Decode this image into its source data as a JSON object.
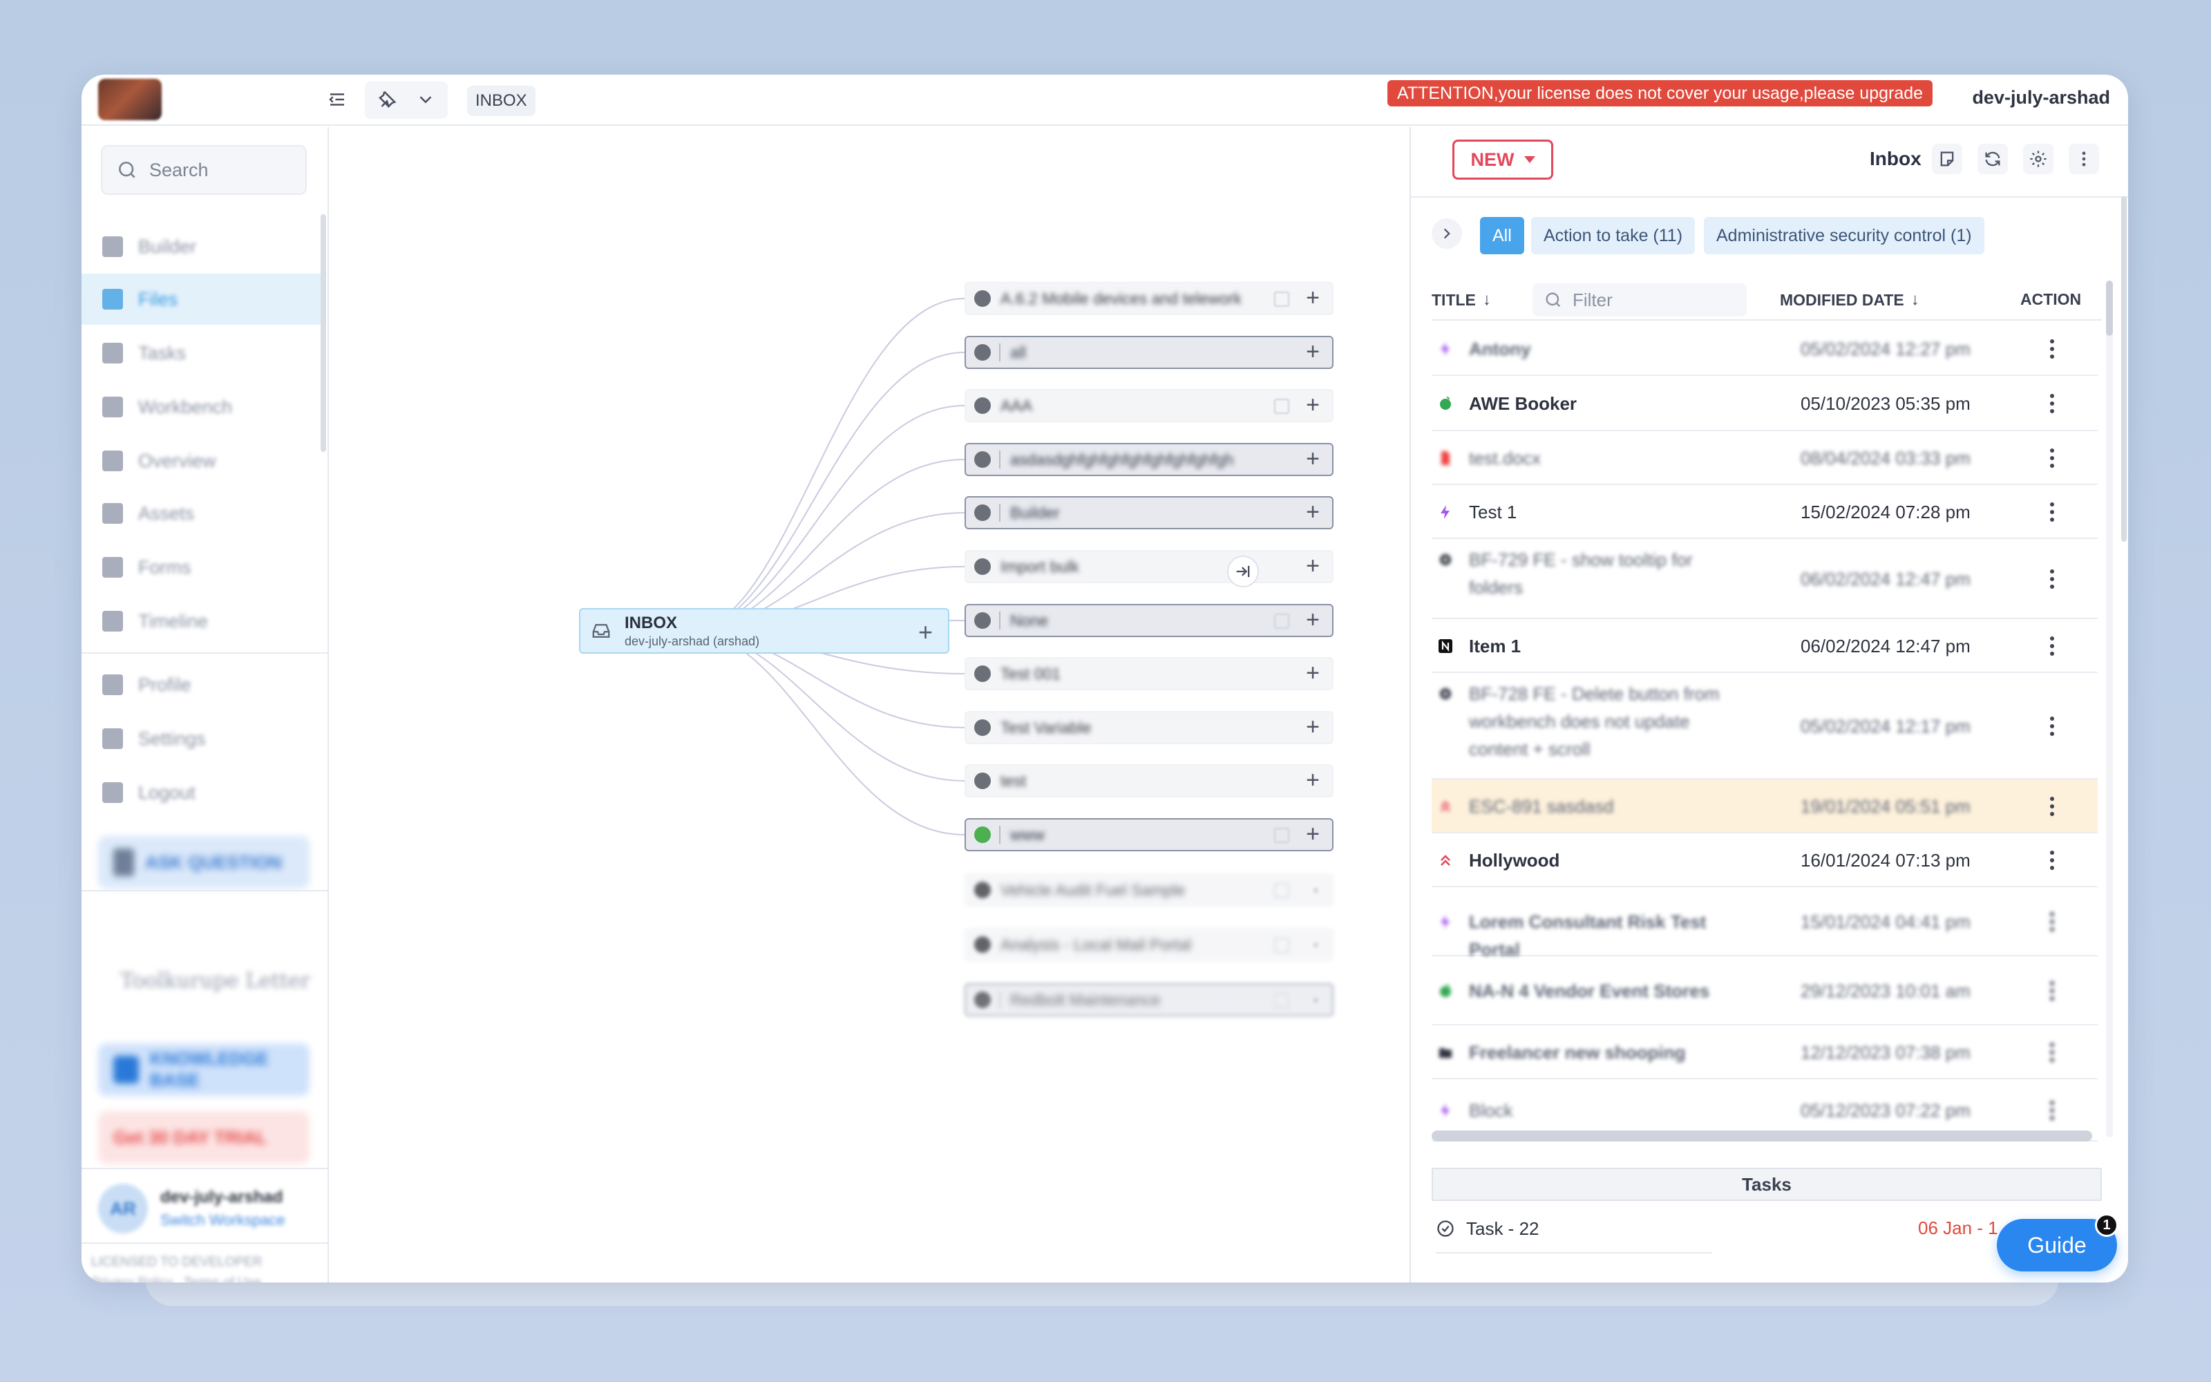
{
  "topbar": {
    "breadcrumb": "INBOX",
    "license_warning": "ATTENTION,your license does not cover your usage,please upgrade",
    "username": "dev-july-arshad"
  },
  "sidebar": {
    "search_placeholder": "Search",
    "items": [
      {
        "label": "Builder",
        "icon": "builder-icon"
      },
      {
        "label": "Files",
        "icon": "files-icon"
      },
      {
        "label": "Tasks",
        "icon": "check-icon"
      },
      {
        "label": "Workbench",
        "icon": "calendar-icon"
      },
      {
        "label": "Overview",
        "icon": "list-icon"
      },
      {
        "label": "Assets",
        "icon": "assets-icon"
      },
      {
        "label": "Forms",
        "icon": "forms-icon"
      },
      {
        "label": "Timeline",
        "icon": "timeline-icon"
      },
      {
        "label": "Profile",
        "icon": "user-icon"
      },
      {
        "label": "Settings",
        "icon": "gear-icon"
      },
      {
        "label": "Logout",
        "icon": "logout-icon"
      }
    ],
    "active_index": 1,
    "promo": {
      "ask_question": "ASK QUESTION",
      "tagline": "Toolkurupe Letter",
      "knowledge": "KNOWLEDGE BASE",
      "alert": "Get 30 DAY TRIAL"
    },
    "user": {
      "initials": "AR",
      "name": "dev-july-arshad",
      "switch": "Switch Workspace"
    },
    "footer": {
      "line1": "LICENSED TO DEVELOPER",
      "privacy": "Privacy Policy",
      "terms": "Terms of Use"
    }
  },
  "canvas": {
    "root": {
      "title": "INBOX",
      "subtitle": "dev-july-arshad (arshad)"
    },
    "children": [
      {
        "label": "A.6.2 Mobile devices and telework",
        "style": "plain",
        "dot": "#6b6f78"
      },
      {
        "label": "all",
        "style": "boxed",
        "dot": "#6b6f78"
      },
      {
        "label": "AAA",
        "style": "plain",
        "dot": "#6b6f78"
      },
      {
        "label": "asdasdghfghfghfghfghfghfghfgh",
        "style": "boxed",
        "dot": "#6b6f78"
      },
      {
        "label": "Builder",
        "style": "boxed",
        "dot": "#6b6f78"
      },
      {
        "label": "Import bulk",
        "style": "plain",
        "dot": "#6b6f78"
      },
      {
        "label": "None",
        "style": "boxed",
        "dot": "#6b6f78"
      },
      {
        "label": "Test 001",
        "style": "plain",
        "dot": "#6b6f78"
      },
      {
        "label": "Test Variable",
        "style": "plain",
        "dot": "#6b6f78"
      },
      {
        "label": "test",
        "style": "plain",
        "dot": "#6b6f78"
      },
      {
        "label": "www",
        "style": "boxed",
        "dot": "#4caf50"
      },
      {
        "label": "Vehicle Audit Fuel Sample",
        "style": "plain",
        "dot": "#3a3d44"
      },
      {
        "label": "Analysis - Local Mail Portal",
        "style": "plain",
        "dot": "#3a3d44"
      },
      {
        "label": "Redbolt Maintenance",
        "style": "boxed",
        "dot": "#3a3d44"
      }
    ]
  },
  "panel": {
    "new_label": "NEW",
    "title": "Inbox",
    "tabs": [
      {
        "label": "All",
        "active": true
      },
      {
        "label": "Action to take (11)",
        "active": false
      },
      {
        "label": "Administrative security control (1)",
        "active": false
      }
    ],
    "columns": {
      "title": "TITLE",
      "modified": "MODIFIED DATE",
      "action": "ACTION",
      "filter_placeholder": "Filter"
    },
    "rows": [
      {
        "title": "Antony",
        "date": "05/02/2024 12:27 pm",
        "icon": "bolt-icon",
        "color": "#a855f7",
        "blur": true,
        "bold": true
      },
      {
        "title": "AWE Booker",
        "date": "05/10/2023 05:35 pm",
        "icon": "apple-icon",
        "color": "#34a853",
        "blur": false,
        "bold": true
      },
      {
        "title": "test.docx",
        "date": "08/04/2024 03:33 pm",
        "icon": "doc-icon",
        "color": "#ef4444",
        "blur": true,
        "bold": false
      },
      {
        "title": "Test 1",
        "date": "15/02/2024 07:28 pm",
        "icon": "bolt-icon",
        "color": "#a855f7",
        "blur": false,
        "bold": false
      },
      {
        "title": "BF-729 FE - show tooltip for folders",
        "date": "06/02/2024 12:47 pm",
        "icon": "gear-icon",
        "color": "#2f3340",
        "blur": true,
        "bold": false
      },
      {
        "title": "Item 1",
        "date": "06/02/2024 12:47 pm",
        "icon": "n-icon",
        "color": "#111111",
        "blur": false,
        "bold": true
      },
      {
        "title": "BF-728 FE - Delete button from workbench does not update content + scroll",
        "date": "05/02/2024 12:17 pm",
        "icon": "gear-icon",
        "color": "#2f3340",
        "blur": true,
        "bold": false
      },
      {
        "title": "ESC-891 sasdasd",
        "date": "19/01/2024 05:51 pm",
        "icon": "chevron-up-icon",
        "color": "#e3485a",
        "blur": true,
        "bold": false
      },
      {
        "title": "Hollywood",
        "date": "16/01/2024 07:13 pm",
        "icon": "chevron-up-icon",
        "color": "#e3485a",
        "blur": false,
        "bold": true
      },
      {
        "title": "Lorem Consultant Risk Test Portal",
        "date": "15/01/2024 04:41 pm",
        "icon": "bolt-icon",
        "color": "#a855f7",
        "blur": true,
        "bold": true
      },
      {
        "title": "NA-N 4 Vendor Event Stores",
        "date": "29/12/2023 10:01 am",
        "icon": "apple-icon",
        "color": "#34a853",
        "blur": true,
        "bold": true
      },
      {
        "title": "Freelancer new shooping",
        "date": "12/12/2023 07:38 pm",
        "icon": "folder-icon",
        "color": "#2f3340",
        "blur": true,
        "bold": true
      },
      {
        "title": "Block",
        "date": "05/12/2023 07:22 pm",
        "icon": "bolt-icon",
        "color": "#a855f7",
        "blur": true,
        "bold": false
      }
    ],
    "tasks_header": "Tasks",
    "task": {
      "label": "Task - 22",
      "date": "06 Jan - 1"
    }
  },
  "guide": {
    "label": "Guide",
    "badge": "1"
  }
}
